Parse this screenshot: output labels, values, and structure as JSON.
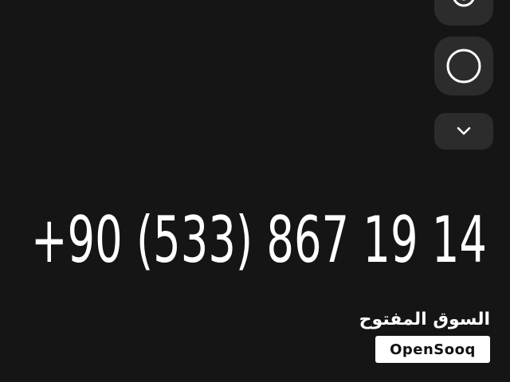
{
  "phone_number": "+90 (533) 867 19 14",
  "side_buttons": [
    {
      "icon": "at-sign-icon"
    },
    {
      "icon": "circle-icon"
    },
    {
      "icon": "chevron-down-icon"
    }
  ],
  "watermark": {
    "arabic": "السوق المفتوح",
    "latin": "OpenSooq"
  },
  "colors": {
    "background": "#151515",
    "button": "#2c2c2c",
    "text": "#ffffff"
  }
}
